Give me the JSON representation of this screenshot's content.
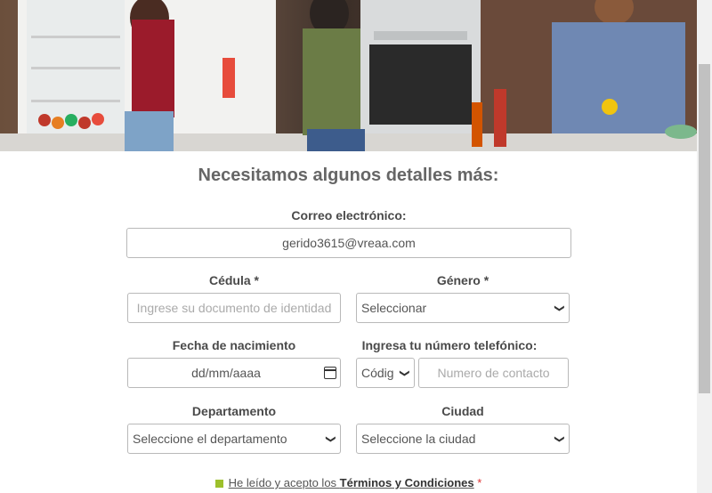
{
  "form": {
    "title": "Necesitamos algunos detalles más:",
    "email": {
      "label": "Correo electrónico:",
      "value": "gerido3615@vreaa.com"
    },
    "cedula": {
      "label": "Cédula *",
      "placeholder": "Ingrese su documento de identidad"
    },
    "genero": {
      "label": "Género *",
      "selected": "Seleccionar"
    },
    "fecha": {
      "label": "Fecha de nacimiento",
      "value": "dd/mm/aaaa"
    },
    "telefono": {
      "label": "Ingresa tu número telefónico:",
      "code_selected": "Códig",
      "placeholder": "Numero de contacto"
    },
    "departamento": {
      "label": "Departamento",
      "selected": "Seleccione el departamento"
    },
    "ciudad": {
      "label": "Ciudad",
      "selected": "Seleccione la ciudad"
    },
    "terms": {
      "prefix": "He leído y acepto los ",
      "link": "Términos y Condiciones",
      "required": "*"
    }
  },
  "colors": {
    "accent": "#9dc02c",
    "title": "#666666"
  }
}
